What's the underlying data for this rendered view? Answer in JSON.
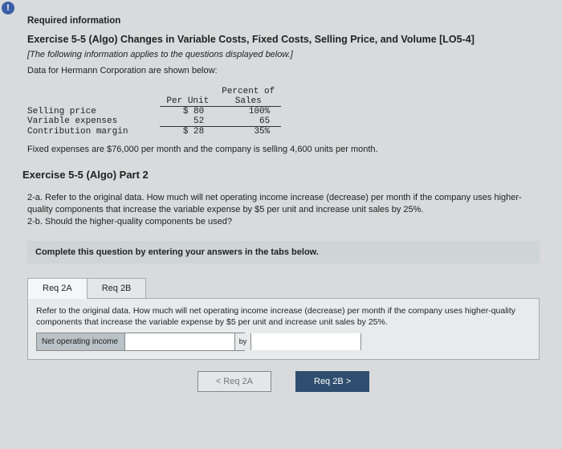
{
  "alert_glyph": "!",
  "required_info": "Required information",
  "exercise_title": "Exercise 5-5 (Algo) Changes in Variable Costs, Fixed Costs, Selling Price, and Volume [LO5-4]",
  "italic_note": "[The following information applies to the questions displayed below.]",
  "data_intro": "Data for Hermann Corporation are shown below:",
  "table": {
    "h_per_unit": "Per Unit",
    "h_percent": "Percent of Sales",
    "rows": [
      {
        "label": "Selling price",
        "per_unit": "$ 80",
        "pct": "100%"
      },
      {
        "label": "Variable expenses",
        "per_unit": "52",
        "pct": "65"
      },
      {
        "label": "Contribution margin",
        "per_unit": "$ 28",
        "pct": "35%"
      }
    ]
  },
  "fixed_note": "Fixed expenses are $76,000 per month and the company is selling 4,600 units per month.",
  "part_title": "Exercise 5-5 (Algo) Part 2",
  "q_2a": "2-a. Refer to the original data. How much will net operating income increase (decrease) per month if the company uses higher-quality components that increase the variable expense by $5 per unit and increase unit sales by 25%.",
  "q_2b": "2-b. Should the higher-quality components be used?",
  "complete_instr": "Complete this question by entering your answers in the tabs below.",
  "tabs": {
    "a": "Req 2A",
    "b": "Req 2B"
  },
  "panel_text": "Refer to the original data. How much will net operating income increase (decrease) per month if the company uses higher-quality components that increase the variable expense by $5 per unit and increase unit sales by 25%.",
  "answer_label": "Net operating income",
  "answer_mid": "by",
  "nav_prev": "<  Req 2A",
  "nav_next": "Req 2B  >"
}
